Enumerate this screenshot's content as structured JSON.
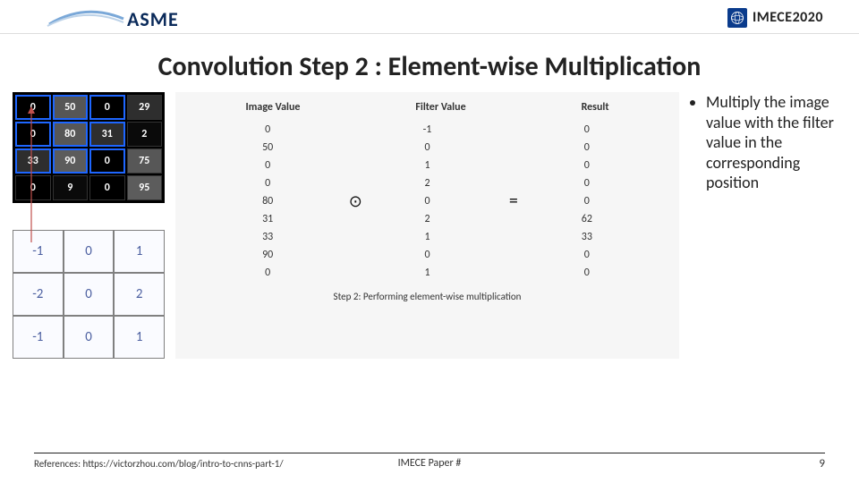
{
  "header": {
    "asme": "ASME",
    "imece": "IMECE2020"
  },
  "title": "Convolution Step 2 : Element-wise Multiplication",
  "image_grid": [
    [
      0,
      50,
      0,
      29
    ],
    [
      0,
      80,
      31,
      2
    ],
    [
      33,
      90,
      0,
      75
    ],
    [
      0,
      9,
      0,
      95
    ]
  ],
  "filter_grid": [
    [
      -1,
      0,
      1
    ],
    [
      -2,
      0,
      2
    ],
    [
      -1,
      0,
      1
    ]
  ],
  "calc": {
    "headers": [
      "Image Value",
      "Filter Value",
      "Result"
    ],
    "rows": [
      [
        0,
        -1,
        0
      ],
      [
        50,
        0,
        0
      ],
      [
        0,
        1,
        0
      ],
      [
        0,
        2,
        0
      ],
      [
        80,
        0,
        0
      ],
      [
        31,
        2,
        62
      ],
      [
        33,
        1,
        33
      ],
      [
        90,
        0,
        0
      ],
      [
        0,
        1,
        0
      ]
    ],
    "op_dot": "⊙",
    "op_eq": "=",
    "caption": "Step 2: Performing element-wise multiplication"
  },
  "bullet": "Multiply the image value with the filter value in the corresponding position",
  "footer": {
    "references_label": "References:",
    "references_url": "https://victorzhou.com/blog/intro-to-cnns-part-1/",
    "center": "IMECE Paper #",
    "page": "9"
  },
  "chart_data": {
    "type": "table",
    "title": "Element-wise multiplication of 3x3 image patch with Sobel-x filter",
    "columns": [
      "Image Value",
      "Filter Value",
      "Result"
    ],
    "rows": [
      [
        0,
        -1,
        0
      ],
      [
        50,
        0,
        0
      ],
      [
        0,
        1,
        0
      ],
      [
        0,
        2,
        0
      ],
      [
        80,
        0,
        0
      ],
      [
        31,
        2,
        62
      ],
      [
        33,
        1,
        33
      ],
      [
        90,
        0,
        0
      ],
      [
        0,
        1,
        0
      ]
    ]
  }
}
